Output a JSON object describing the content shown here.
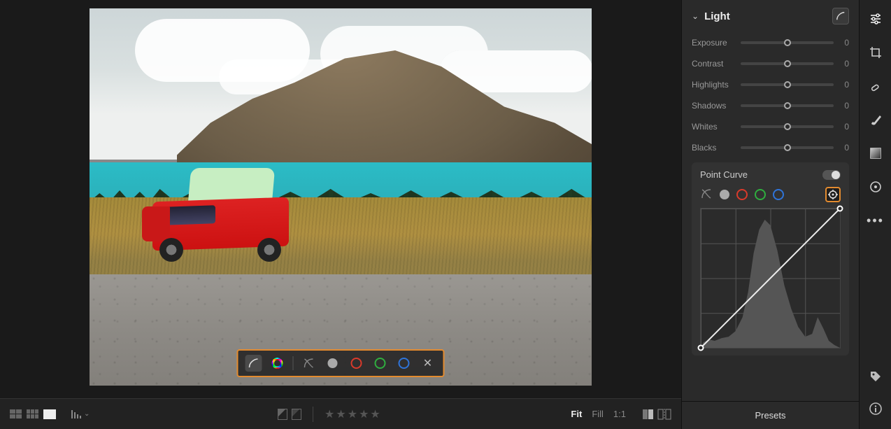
{
  "panel": {
    "light": {
      "title": "Light",
      "sliders": [
        {
          "label": "Exposure",
          "value": "0"
        },
        {
          "label": "Contrast",
          "value": "0"
        },
        {
          "label": "Highlights",
          "value": "0"
        },
        {
          "label": "Shadows",
          "value": "0"
        },
        {
          "label": "Whites",
          "value": "0"
        },
        {
          "label": "Blacks",
          "value": "0"
        }
      ],
      "pointCurve": {
        "title": "Point Curve",
        "channels": [
          "parametric",
          "luminance",
          "red",
          "green",
          "blue"
        ],
        "targetActive": true
      }
    },
    "presets": "Presets"
  },
  "footer": {
    "zoom": {
      "fit": "Fit",
      "fill": "Fill",
      "oneToOne": "1:1"
    }
  },
  "overlay": {
    "channels": [
      "parametric",
      "luminance",
      "red",
      "green",
      "blue"
    ]
  },
  "colors": {
    "accent": "#e38b2f",
    "red": "#d93a2b",
    "green": "#2fae3f",
    "blue": "#2f74d9"
  }
}
